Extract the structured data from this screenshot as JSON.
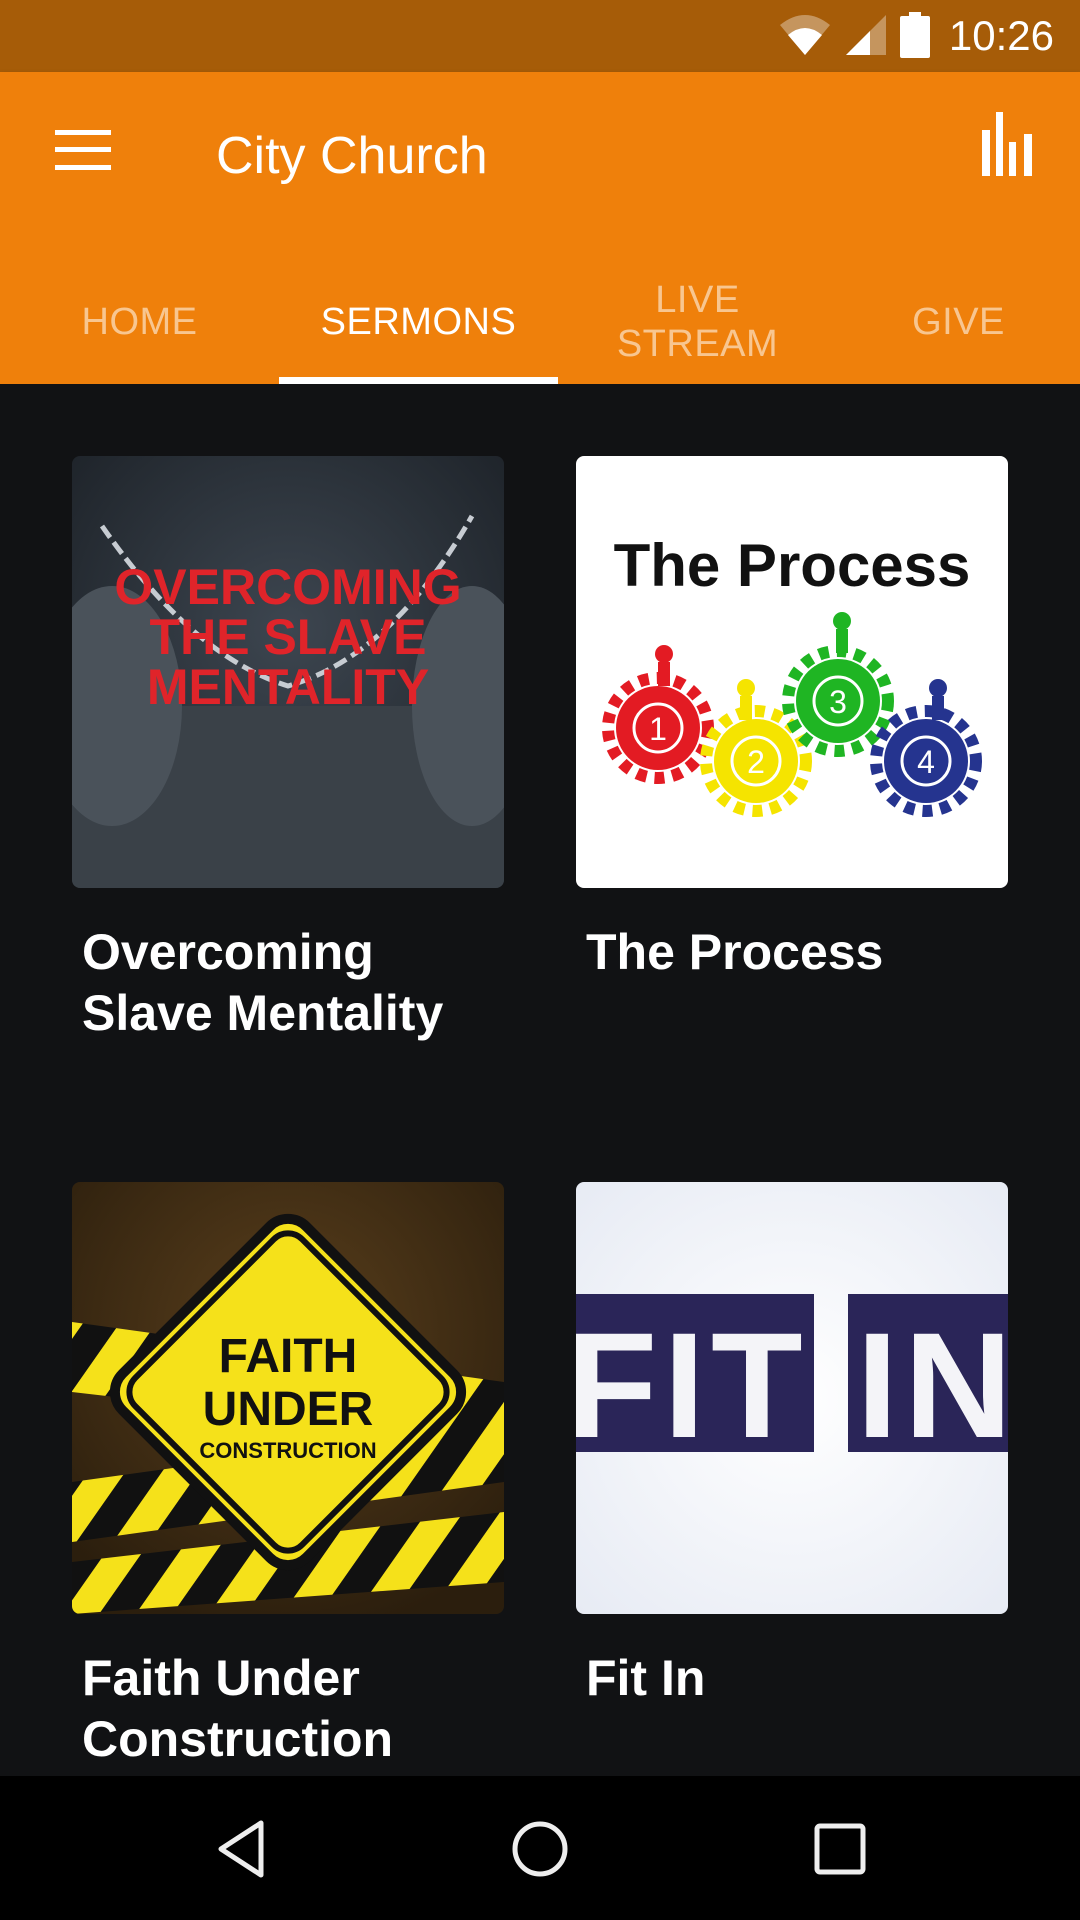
{
  "status_bar": {
    "time": "10:26",
    "icons": [
      "wifi-icon",
      "cell-signal-icon",
      "battery-icon"
    ]
  },
  "app_bar": {
    "title": "City Church",
    "menu_icon": "hamburger-menu-icon",
    "action_icon": "bar-chart-icon",
    "background_color": "#EF800B"
  },
  "tabs": [
    {
      "label": "HOME",
      "active": false
    },
    {
      "label": "SERMONS",
      "active": true
    },
    {
      "label": "LIVE\nSTREAM",
      "active": false
    },
    {
      "label": "GIVE",
      "active": false
    }
  ],
  "sermons": [
    {
      "title": "Overcoming Slave Mentality",
      "art_text": [
        "OVERCOMING",
        "THE SLAVE",
        "MENTALITY"
      ]
    },
    {
      "title": "The Process",
      "art_text": [
        "The Process"
      ],
      "art_numbers": [
        "1",
        "2",
        "3",
        "4"
      ]
    },
    {
      "title": "Faith Under Construction",
      "art_text": [
        "FAITH",
        "UNDER",
        "CONSTRUCTION"
      ]
    },
    {
      "title": "Fit In",
      "art_text": [
        "FIT IN"
      ]
    }
  ],
  "nav_bar": {
    "back": "back-icon",
    "home": "home-icon",
    "recents": "recents-icon"
  }
}
